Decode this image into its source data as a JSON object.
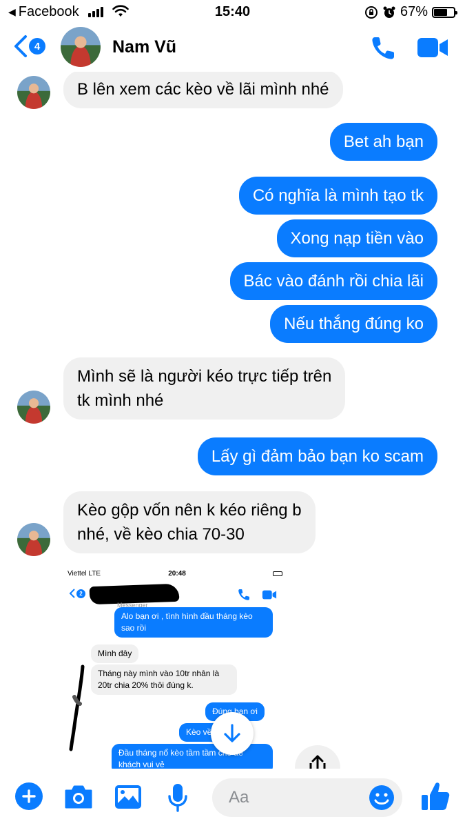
{
  "status_bar": {
    "back_app": "Facebook",
    "time": "15:40",
    "battery": "67%"
  },
  "header": {
    "badge_count": "4",
    "contact_name": "Nam Vũ"
  },
  "messages": {
    "m1": "B lên xem các kèo về lãi mình nhé",
    "m2": "Bet ah bạn",
    "m3": "Có nghĩa là mình tạo tk",
    "m4": "Xong nạp tiền vào",
    "m5": "Bác vào đánh rồi chia lãi",
    "m6": "Nếu thắng đúng ko",
    "m7_line1": "Mình sẽ là người kéo trực tiếp trên",
    "m7_line2": "tk mình nhé",
    "m8": "Lấy gì đảm bảo bạn ko scam",
    "m9_line1": "Kèo gộp vốn nên k kéo riêng b",
    "m9_line2": "nhé, về kèo chia 70-30"
  },
  "embedded_screenshot": {
    "carrier": "Viettel  LTE",
    "time": "20:48",
    "badge_count": "2",
    "subtitle": "Messenger",
    "e1_line1": "Alo bạn ơi , tình hình đầu tháng kèo",
    "e1_line2": "sao rồi",
    "e2": "Mình đây",
    "e3_line1": "Tháng này mình vào 10tr nhân là",
    "e3_line2": "20tr chia 20% thôi đúng k.",
    "e4": "Đúng   bạn ơi",
    "e5": "Kèo về         thôi",
    "e6_line1": "Đầu tháng nổ kèo tầm tầm      cho ae",
    "e6_line2": "khách vui vẻ"
  },
  "composer": {
    "placeholder": "Aa"
  },
  "colors": {
    "accent": "#0a7cff",
    "incoming_bubble": "#f0f0f0"
  },
  "icons": [
    "back-chevron-icon",
    "phone-icon",
    "video-camera-icon",
    "plus-icon",
    "camera-icon",
    "image-icon",
    "microphone-icon",
    "emoji-icon",
    "thumbs-up-icon",
    "arrow-down-icon",
    "share-icon"
  ]
}
